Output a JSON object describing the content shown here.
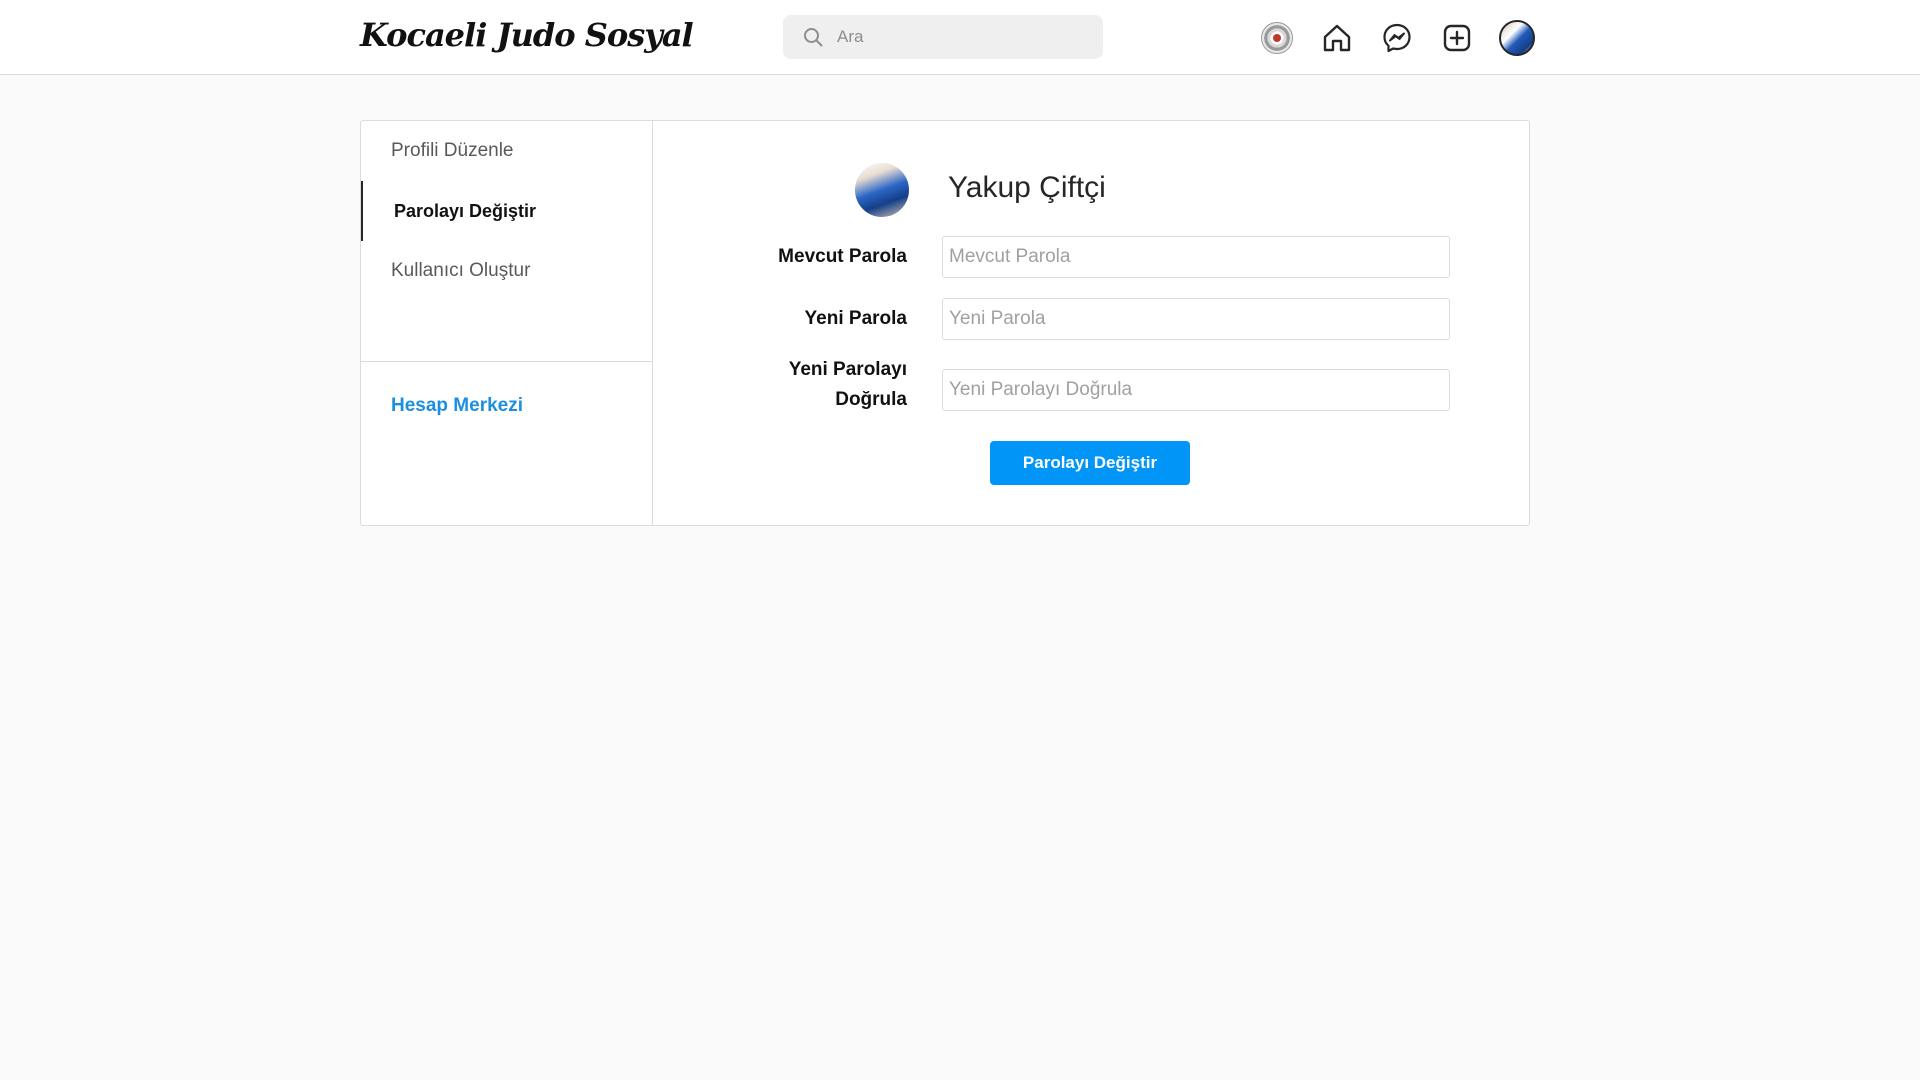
{
  "header": {
    "logo_text": "Kocaeli Judo Sosyal",
    "search": {
      "placeholder": "Ara",
      "value": ""
    },
    "icons": [
      "club-emblem-icon",
      "home-icon",
      "messenger-icon",
      "new-post-icon",
      "avatar"
    ]
  },
  "sidebar": {
    "items": [
      {
        "label": "Profili Düzenle",
        "active": false
      },
      {
        "label": "Parolayı Değiştir",
        "active": true
      },
      {
        "label": "Kullanıcı Oluştur",
        "active": false
      }
    ],
    "account_center_label": "Hesap Merkezi"
  },
  "profile": {
    "name": "Yakup Çiftçi"
  },
  "form": {
    "current_password": {
      "label": "Mevcut Parola",
      "placeholder": "Mevcut Parola",
      "value": ""
    },
    "new_password": {
      "label": "Yeni Parola",
      "placeholder": "Yeni Parola",
      "value": ""
    },
    "confirm_password": {
      "label_line1": "Yeni Parolayı",
      "label_line2": "Doğrula",
      "placeholder": "Yeni Parolayı Doğrula",
      "value": ""
    },
    "submit_label": "Parolayı Değiştir"
  },
  "colors": {
    "accent": "#0095f6",
    "link": "#1c8fe0",
    "background": "#fafafa",
    "border": "#dbdbdb"
  }
}
